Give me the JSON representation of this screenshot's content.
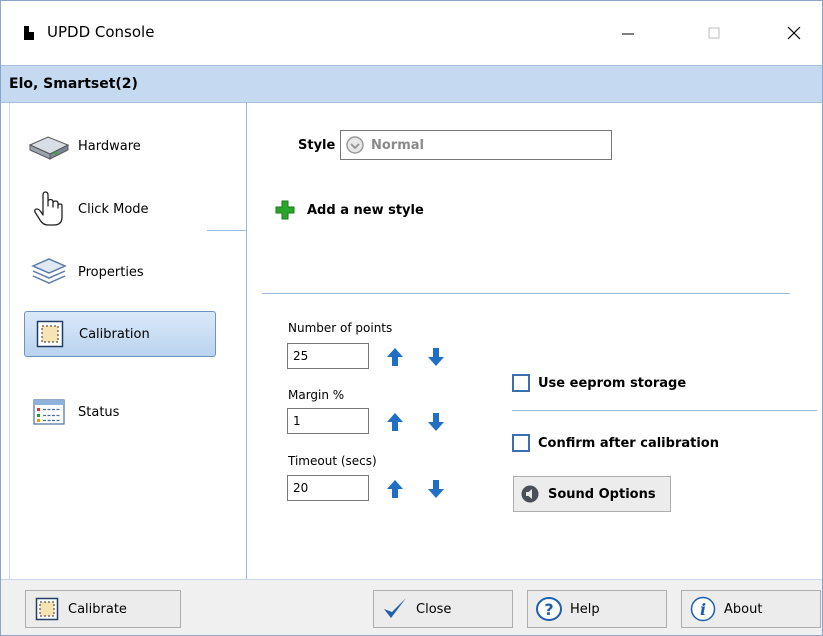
{
  "window": {
    "title": "UPDD Console",
    "controls": {
      "minimize": "minimize",
      "maximize": "maximize",
      "close": "close"
    }
  },
  "device": {
    "name": "Elo, Smartset(2)"
  },
  "sidebar": {
    "items": [
      {
        "label": "Hardware",
        "icon": "hardware-drive-icon",
        "active": false
      },
      {
        "label": "Click Mode",
        "icon": "hand-pointer-icon",
        "active": false
      },
      {
        "label": "Properties",
        "icon": "layers-icon",
        "active": false
      },
      {
        "label": "Calibration",
        "icon": "calibration-frame-icon",
        "active": true
      },
      {
        "label": "Status",
        "icon": "status-list-icon",
        "active": false
      }
    ]
  },
  "main": {
    "style_label": "Style",
    "style_value": "Normal",
    "add_style_label": "Add a new style",
    "fields": [
      {
        "label": "Number of points",
        "value": "25"
      },
      {
        "label": "Margin %",
        "value": "1"
      },
      {
        "label": "Timeout (secs)",
        "value": "20"
      }
    ],
    "eeprom_label": "Use eeprom storage",
    "eeprom_checked": false,
    "confirm_label": "Confirm after calibration",
    "confirm_checked": false,
    "sound_options_label": "Sound Options"
  },
  "footer": {
    "calibrate_label": "Calibrate",
    "close_label": "Close",
    "help_label": "Help",
    "about_label": "About"
  },
  "colors": {
    "accent": "#1f6fc5",
    "band": "#c5daf0",
    "active_item": "#b9d3ef",
    "plus_green": "#2aa52a"
  }
}
